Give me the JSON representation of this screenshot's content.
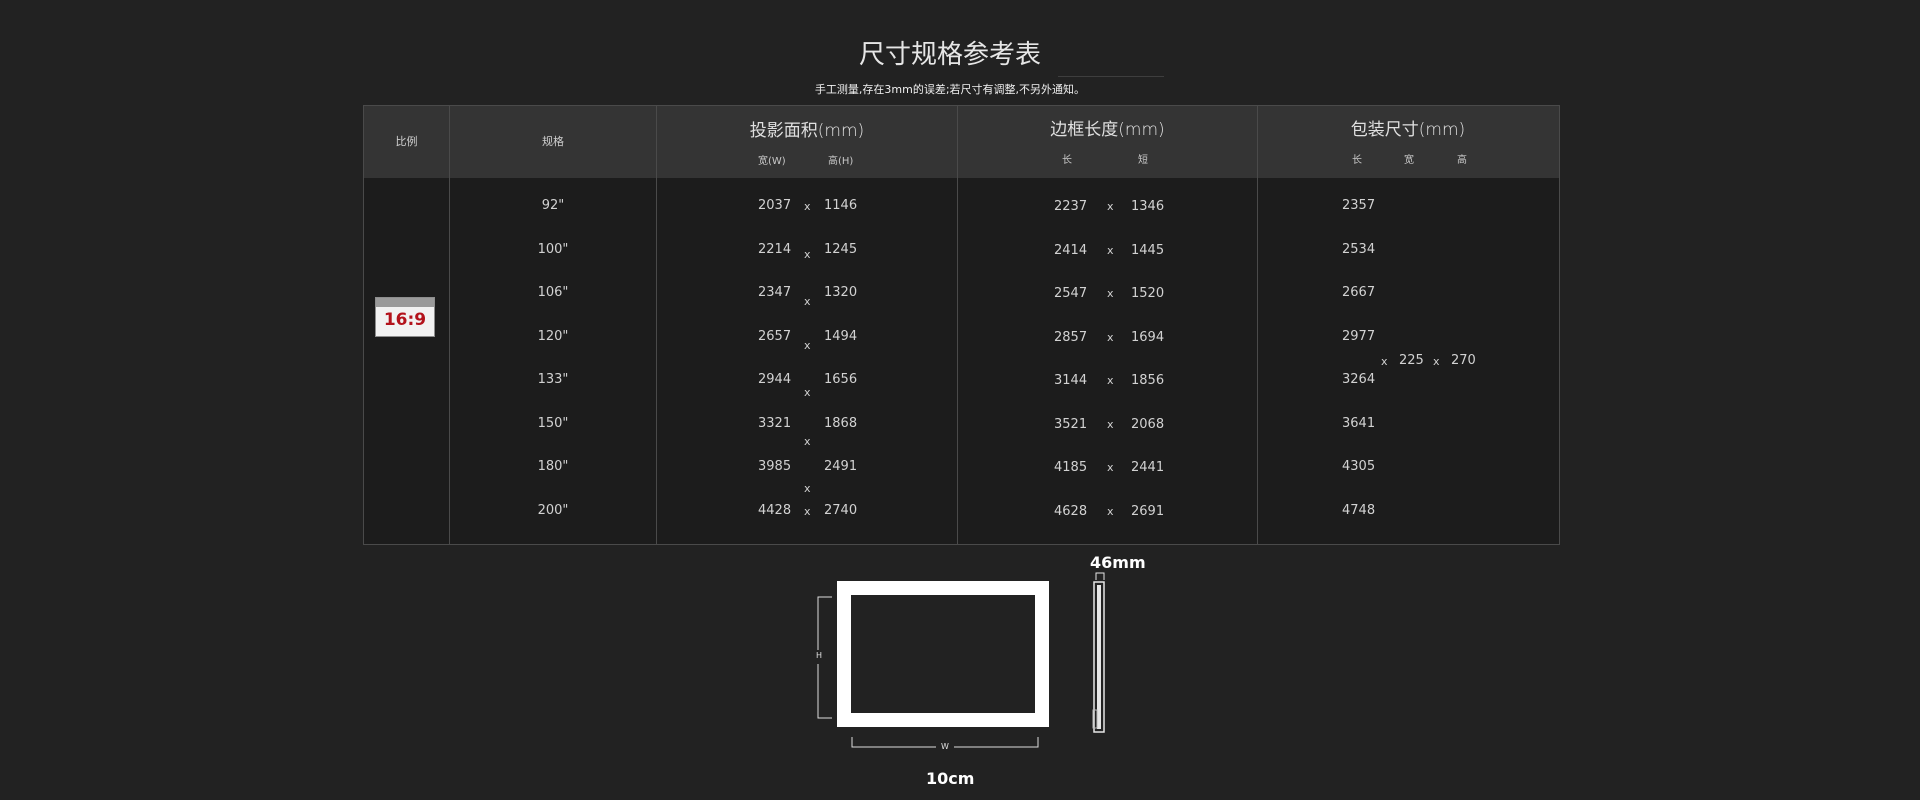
{
  "title": "尺寸规格参考表",
  "subtitle": "手工测量,存在3mm的误差;若尺寸有调整,不另外通知。",
  "headers": {
    "ratio": "比例",
    "spec": "规格",
    "projection": "投影面积(mm)",
    "projection_w": "宽(W)",
    "projection_h": "高(H)",
    "frame": "边框长度(mm)",
    "frame_long": "长",
    "frame_short": "短",
    "package": "包装尺寸(mm)",
    "package_l": "长",
    "package_w": "宽",
    "package_h": "高"
  },
  "ratio_label": "16:9",
  "separator": "x",
  "rows": [
    {
      "spec": "92\"",
      "proj_w": "2037",
      "proj_h": "1146",
      "frame_l": "2237",
      "frame_s": "1346",
      "pkg_l": "2357"
    },
    {
      "spec": "100\"",
      "proj_w": "2214",
      "proj_h": "1245",
      "frame_l": "2414",
      "frame_s": "1445",
      "pkg_l": "2534"
    },
    {
      "spec": "106\"",
      "proj_w": "2347",
      "proj_h": "1320",
      "frame_l": "2547",
      "frame_s": "1520",
      "pkg_l": "2667"
    },
    {
      "spec": "120\"",
      "proj_w": "2657",
      "proj_h": "1494",
      "frame_l": "2857",
      "frame_s": "1694",
      "pkg_l": "2977"
    },
    {
      "spec": "133\"",
      "proj_w": "2944",
      "proj_h": "1656",
      "frame_l": "3144",
      "frame_s": "1856",
      "pkg_l": "3264"
    },
    {
      "spec": "150\"",
      "proj_w": "3321",
      "proj_h": "1868",
      "frame_l": "3521",
      "frame_s": "2068",
      "pkg_l": "3641"
    },
    {
      "spec": "180\"",
      "proj_w": "3985",
      "proj_h": "2491",
      "frame_l": "4185",
      "frame_s": "2441",
      "pkg_l": "4305"
    },
    {
      "spec": "200\"",
      "proj_w": "4428",
      "proj_h": "2740",
      "frame_l": "4628",
      "frame_s": "2691",
      "pkg_l": "4748"
    }
  ],
  "package_common": {
    "width": "225",
    "height": "270"
  },
  "diagram": {
    "h_label": "H",
    "w_label": "W",
    "depth_label": "46mm",
    "border_label": "10cm"
  }
}
